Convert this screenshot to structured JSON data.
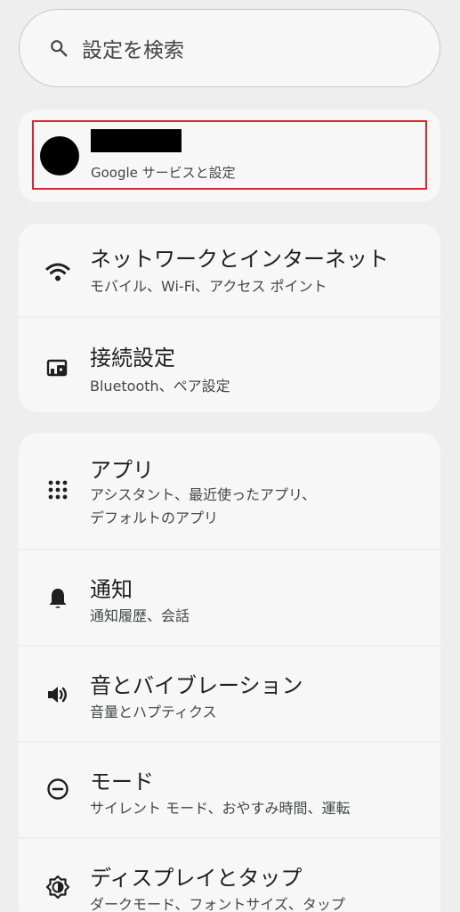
{
  "search": {
    "placeholder": "設定を検索",
    "icon": "search-icon"
  },
  "account": {
    "subtitle": "Google サービスと設定"
  },
  "groups": [
    {
      "items": [
        {
          "title": "ネットワークとインターネット",
          "subtitle": "モバイル、Wi-Fi、アクセス ポイント",
          "icon": "wifi-icon"
        },
        {
          "title": "接続設定",
          "subtitle": "Bluetooth、ペア設定",
          "icon": "connected-devices-icon"
        }
      ]
    },
    {
      "items": [
        {
          "title": "アプリ",
          "subtitle_line1": "アシスタント、最近使ったアプリ、",
          "subtitle_line2": "デフォルトのアプリ",
          "icon": "apps-grid-icon"
        },
        {
          "title": "通知",
          "subtitle": "通知履歴、会話",
          "icon": "bell-icon"
        },
        {
          "title": "音とバイブレーション",
          "subtitle": "音量とハプティクス",
          "icon": "volume-icon"
        },
        {
          "title": "モード",
          "subtitle": "サイレント モード、おやすみ時間、運転",
          "icon": "modes-icon"
        },
        {
          "title": "ディスプレイとタップ",
          "subtitle": "ダークモード、フォントサイズ、タップ",
          "icon": "display-brightness-icon"
        }
      ]
    }
  ]
}
